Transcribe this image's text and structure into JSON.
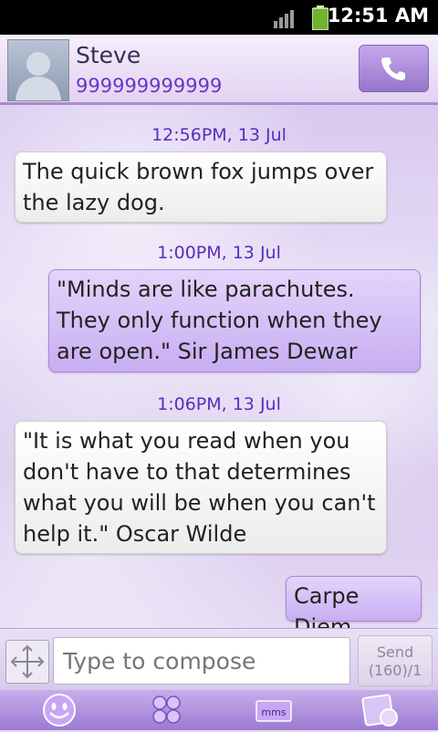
{
  "status_bar": {
    "time": "12:51 AM"
  },
  "contact": {
    "name": "Steve",
    "number": "999999999999"
  },
  "messages": [
    {
      "timestamp": "12:56PM, 13 Jul",
      "direction": "incoming",
      "text": "The quick brown fox jumps over the lazy dog."
    },
    {
      "timestamp": "1:00PM, 13 Jul",
      "direction": "outgoing",
      "text": "\"Minds are like parachutes. They only function when they are open.\" Sir James Dewar"
    },
    {
      "timestamp": "1:06PM, 13 Jul",
      "direction": "incoming",
      "text": "\"It is what you read when you don't have to that determines what you will be when you can't help it.\" Oscar Wilde"
    },
    {
      "timestamp": "",
      "direction": "outgoing",
      "text": "Carpe Diem"
    }
  ],
  "compose": {
    "placeholder": "Type to compose",
    "send_label": "Send",
    "send_counter": "(160)/1"
  },
  "toolbar": {
    "mms_label": "mms"
  },
  "colors": {
    "accent": "#9d7ad2",
    "timestamp": "#5a2cc0",
    "number": "#6a36c6",
    "outgoing_bubble": "#c8aef2"
  },
  "icons": [
    "signal-icon",
    "battery-icon",
    "phone-icon",
    "expand-icon",
    "smiley-icon",
    "templates-icon",
    "mms-icon",
    "theme-icon"
  ]
}
